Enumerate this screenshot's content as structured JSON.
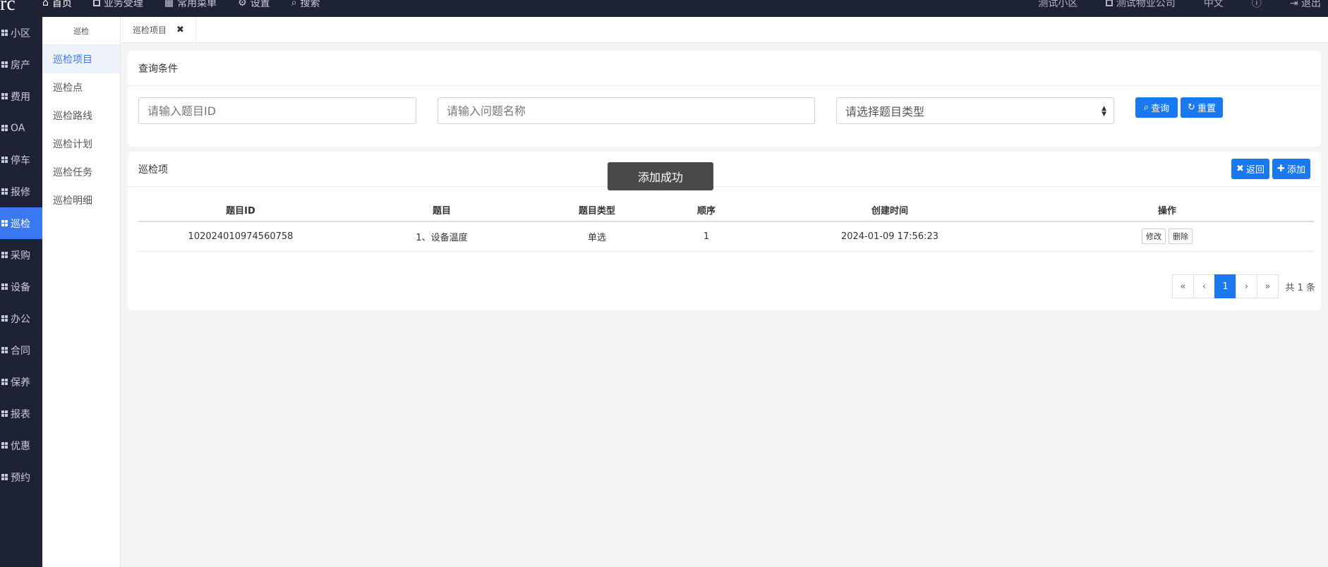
{
  "topbar": {
    "brand": "rc",
    "nav": [
      "首页",
      "业务受理",
      "常用菜单",
      "设置",
      "搜索"
    ],
    "right": [
      "测试小区",
      "测试物业公司",
      "中文",
      "",
      "退出"
    ]
  },
  "sidebar": {
    "items": [
      "小区",
      "房产",
      "费用",
      "OA",
      "停车",
      "报修",
      "巡检",
      "采购",
      "设备",
      "办公",
      "合同",
      "保养",
      "报表",
      "优惠",
      "预约"
    ]
  },
  "subside": {
    "title": "巡检",
    "items": [
      "巡检项目",
      "巡检点",
      "巡检路线",
      "巡检计划",
      "巡检任务",
      "巡检明细"
    ]
  },
  "tab": {
    "label": "巡检项目",
    "close": "✖"
  },
  "query": {
    "title": "查询条件",
    "id_placeholder": "请输入题目ID",
    "name_placeholder": "请输入问题名称",
    "type_placeholder": "请选择题目类型",
    "search_label": "查询",
    "reset_label": "重置"
  },
  "list": {
    "title": "巡检项",
    "back_label": "返回",
    "add_label": "添加",
    "columns": [
      "题目ID",
      "题目",
      "题目类型",
      "顺序",
      "创建时间",
      "操作"
    ],
    "rows": [
      {
        "id": "102024010974560758",
        "title": "1、设备温度",
        "type": "单选",
        "order": "1",
        "created": "2024-01-09 17:56:23",
        "edit": "修改",
        "delete": "删除"
      }
    ]
  },
  "pager": {
    "first": "«",
    "prev": "‹",
    "page": "1",
    "next": "›",
    "last": "»",
    "total": "共 1 条"
  },
  "toast": "添加成功",
  "colors": {
    "primary": "#1a78f0",
    "sidebar": "#1e2235",
    "active": "#3a78f2"
  }
}
